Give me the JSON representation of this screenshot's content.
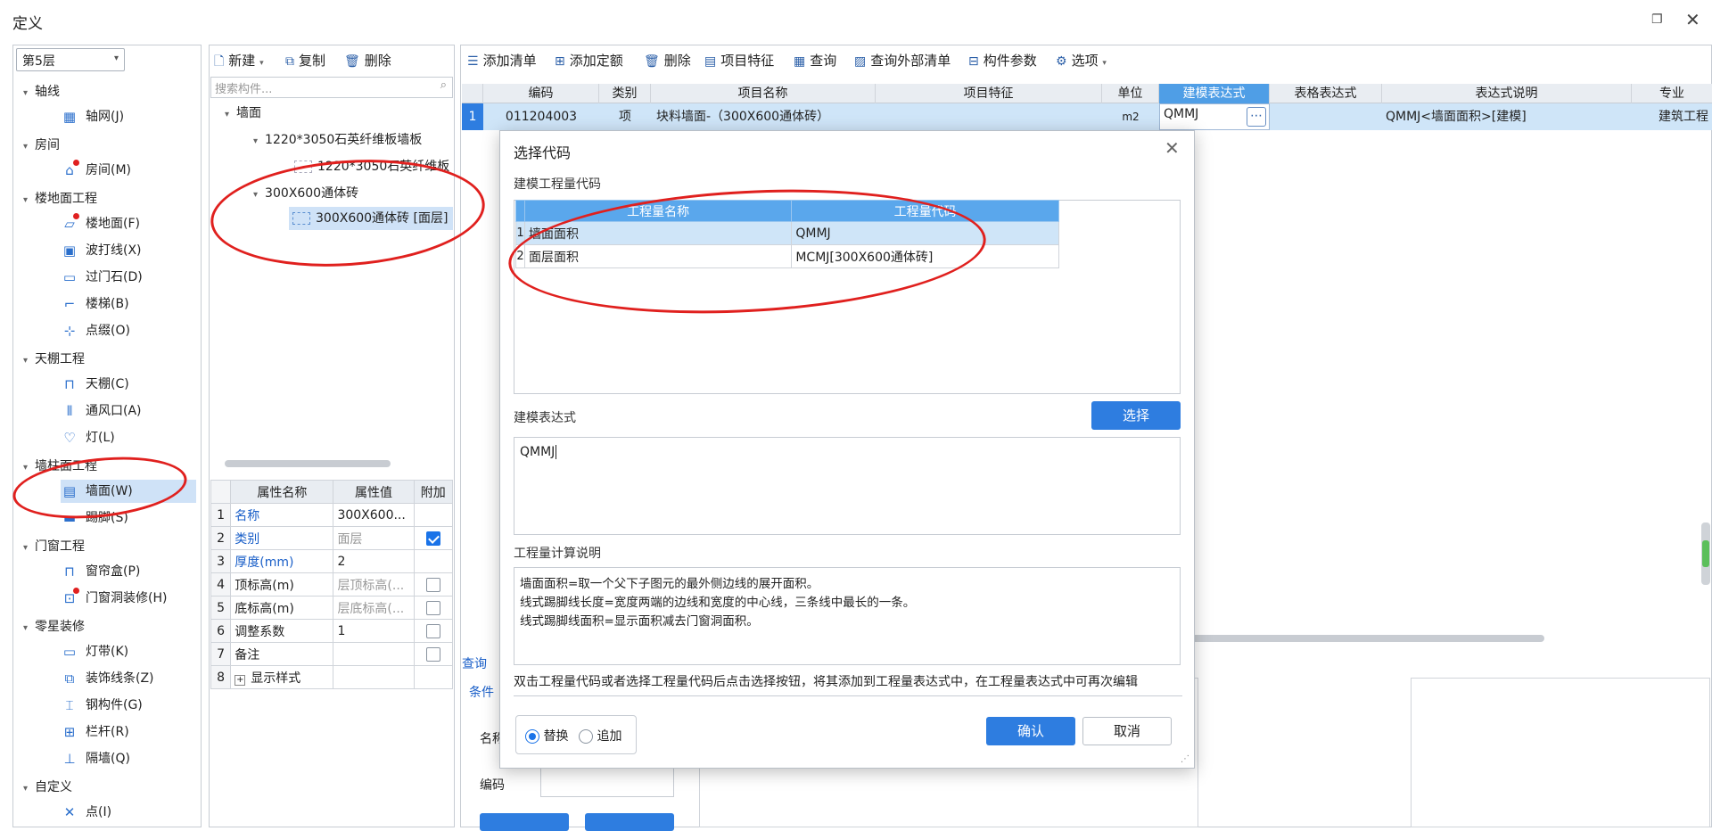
{
  "window": {
    "title": "定义"
  },
  "left": {
    "floor": "第5层",
    "sections": [
      {
        "label": "轴线",
        "items": [
          {
            "label": "轴网(J)",
            "icon": "grid-icon"
          }
        ]
      },
      {
        "label": "房间",
        "items": [
          {
            "label": "房间(M)",
            "icon": "room-icon"
          }
        ]
      },
      {
        "label": "楼地面工程",
        "items": [
          {
            "label": "楼地面(F)",
            "icon": "floor-icon"
          },
          {
            "label": "波打线(X)",
            "icon": "border-line-icon"
          },
          {
            "label": "过门石(D)",
            "icon": "door-stone-icon"
          },
          {
            "label": "楼梯(B)",
            "icon": "stairs-icon"
          },
          {
            "label": "点缀(O)",
            "icon": "ornament-icon"
          }
        ]
      },
      {
        "label": "天棚工程",
        "items": [
          {
            "label": "天棚(C)",
            "icon": "ceiling-icon"
          },
          {
            "label": "通风口(A)",
            "icon": "vent-icon"
          },
          {
            "label": "灯(L)",
            "icon": "lamp-icon"
          }
        ]
      },
      {
        "label": "墙柱面工程",
        "items": [
          {
            "label": "墙面(W)",
            "icon": "wall-icon"
          },
          {
            "label": "踢脚(S)",
            "icon": "skirting-icon"
          }
        ]
      },
      {
        "label": "门窗工程",
        "items": [
          {
            "label": "窗帘盒(P)",
            "icon": "curtain-box-icon"
          },
          {
            "label": "门窗洞装修(H)",
            "icon": "opening-icon"
          }
        ]
      },
      {
        "label": "零星装修",
        "items": [
          {
            "label": "灯带(K)",
            "icon": "light-strip-icon"
          },
          {
            "label": "装饰线条(Z)",
            "icon": "molding-icon"
          },
          {
            "label": "钢构件(G)",
            "icon": "steel-icon"
          },
          {
            "label": "栏杆(R)",
            "icon": "railing-icon"
          },
          {
            "label": "隔墙(Q)",
            "icon": "partition-icon"
          }
        ]
      },
      {
        "label": "自定义",
        "items": [
          {
            "label": "点(I)",
            "icon": "point-icon"
          }
        ]
      }
    ]
  },
  "mid": {
    "toolbar": {
      "new": "新建",
      "copy": "复制",
      "delete": "删除"
    },
    "search_placeholder": "搜索构件...",
    "tree": {
      "root": "墙面",
      "group1": "1220*3050石英纤维板墙板",
      "group1_child": "1220*3050石英纤维板",
      "group2": "300X600通体砖",
      "group2_child": "300X600通体砖 [面层]"
    },
    "props": {
      "headers": [
        "属性名称",
        "属性值",
        "附加"
      ],
      "rows": [
        {
          "n": "1",
          "name": "名称",
          "value": "300X600..."
        },
        {
          "n": "2",
          "name": "类别",
          "value": "面层"
        },
        {
          "n": "3",
          "name": "厚度(mm)",
          "value": "2"
        },
        {
          "n": "4",
          "name": "顶标高(m)",
          "value": "层顶标高(..."
        },
        {
          "n": "5",
          "name": "底标高(m)",
          "value": "层底标高(..."
        },
        {
          "n": "6",
          "name": "调整系数",
          "value": "1"
        },
        {
          "n": "7",
          "name": "备注",
          "value": ""
        },
        {
          "n": "8",
          "name": "显示样式",
          "value": ""
        }
      ]
    }
  },
  "right": {
    "toolbar": [
      "添加清单",
      "添加定额",
      "删除",
      "项目特征",
      "查询",
      "查询外部清单",
      "构件参数",
      "选项"
    ],
    "headers": [
      "编码",
      "类别",
      "项目名称",
      "项目特征",
      "单位",
      "建模表达式",
      "表格表达式",
      "表达式说明",
      "专业"
    ],
    "row": {
      "n": "1",
      "code": "011204003",
      "type": "项",
      "name": "块料墙面-（300X600通体砖）",
      "feature": "",
      "unit": "m2",
      "expr": "QMMJ",
      "table_expr": "",
      "desc": "QMMJ<墙面面积>[建模]",
      "major": "建筑工程"
    },
    "bottom": {
      "tab": "查询",
      "cond_tab": "条件",
      "name_label": "名称",
      "code_label": "编码"
    }
  },
  "dialog": {
    "title": "选择代码",
    "section_codes": "建模工程量代码",
    "code_headers": [
      "工程量名称",
      "工程量代码"
    ],
    "codes": [
      {
        "n": "1",
        "name": "墙面面积",
        "code": "QMMJ"
      },
      {
        "n": "2",
        "name": "面层面积",
        "code": "MCMJ[300X600通体砖]"
      }
    ],
    "select_button": "选择",
    "section_expr": "建模表达式",
    "expr_value": "QMMJ",
    "section_calc": "工程量计算说明",
    "calc_lines": [
      "墙面面积=取一个父下子图元的最外侧边线的展开面积。",
      "线式踢脚线长度=宽度两端的边线和宽度的中心线，三条线中最长的一条。",
      "线式踢脚线面积=显示面积减去门窗洞面积。"
    ],
    "hint": "双击工程量代码或者选择工程量代码后点击选择按钮，将其添加到工程量表达式中，在工程量表达式中可再次编辑",
    "radio_replace": "替换",
    "radio_append": "追加",
    "ok": "确认",
    "cancel": "取消"
  },
  "colors": {
    "accent": "#2e7de0",
    "annotation": "#e0201e",
    "selected_row": "#cfe5f8"
  }
}
